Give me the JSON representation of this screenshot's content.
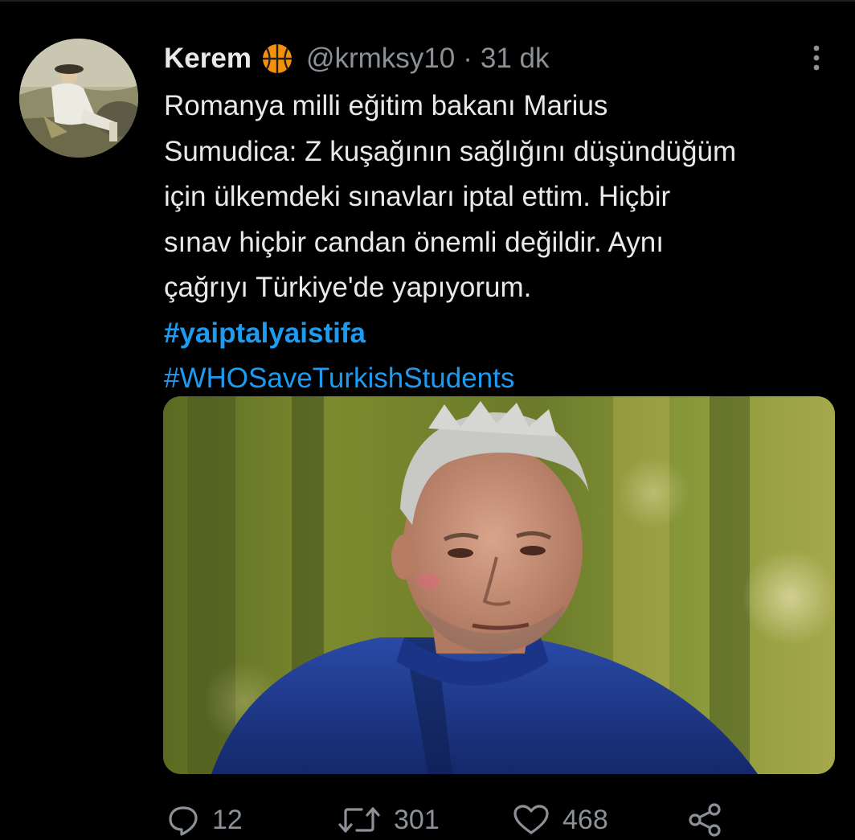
{
  "tweet": {
    "author": {
      "name": "Kerem",
      "emoji_icon": "basketball-icon",
      "handle": "@krmksy10",
      "separator": "·",
      "time": "31 dk"
    },
    "text_lines": [
      "Romanya milli eğitim bakanı Marius",
      "Sumudica: Z kuşağının sağlığını düşündüğüm",
      "için ülkemdeki sınavları iptal ettim. Hiçbir",
      "sınav hiçbir candan önemli değildir. Aynı",
      "çağrıyı Türkiye'de yapıyorum."
    ],
    "hashtags": [
      "#yaiptalyaistifa",
      "#WHOSaveTurkishStudents"
    ],
    "actions": {
      "replies": "12",
      "retweets": "301",
      "likes": "468"
    }
  },
  "icons": {
    "more": "more-vertical-icon",
    "reply": "reply-icon",
    "retweet": "retweet-icon",
    "like": "heart-icon",
    "share": "share-icon"
  },
  "colors": {
    "background": "#000000",
    "text": "#e7e9ea",
    "muted": "#8b9196",
    "link": "#1d9bf0"
  }
}
